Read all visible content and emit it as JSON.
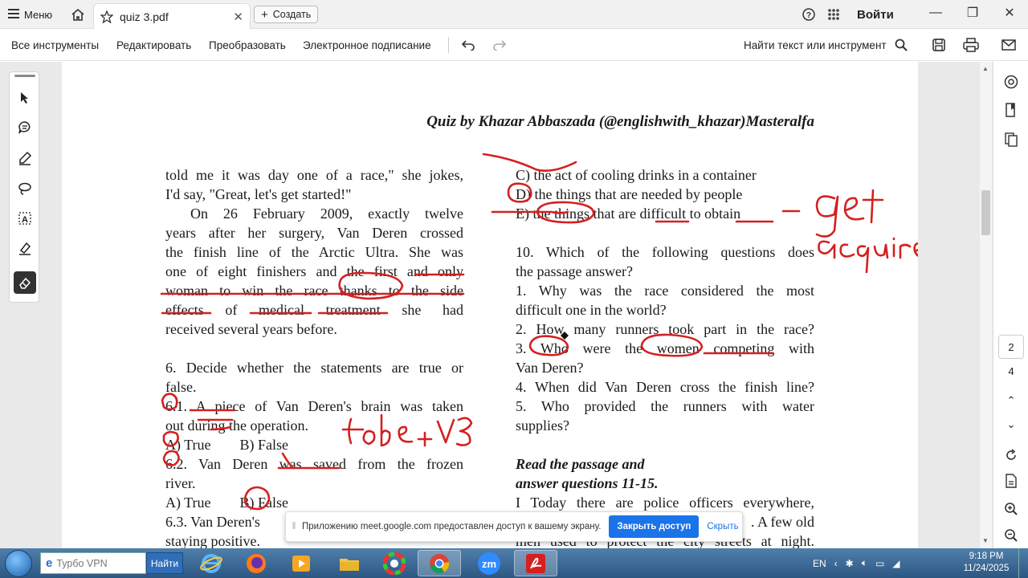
{
  "titlebar": {
    "menu_label": "Меню",
    "tab_title": "quiz 3.pdf",
    "create_label": "Создать",
    "signin_label": "Войти"
  },
  "toolbar": {
    "all_tools": "Все инструменты",
    "edit": "Редактировать",
    "convert": "Преобразовать",
    "esign": "Электронное подписание",
    "search_label": "Найти текст или инструмент"
  },
  "document": {
    "header": "Quiz by Khazar Abbaszada (@englishwith_khazar)Masteralfa",
    "col1": [
      "told me it was day one of a race,\" she jokes,",
      "I'd say, \"Great, let's get started!\"",
      "On 26 February 2009, exactly twelve",
      "years after her surgery, Van Deren crossed",
      "the finish line of the Arctic Ultra. She was",
      "one of eight finishers and the first and only",
      "woman to win the race thanks to the side",
      "effects of medical treatment she had",
      "received several years before.",
      "",
      "6. Decide whether the statements are true or",
      "false.",
      "6.1. A piece of Van Deren's brain was taken",
      "out during the operation.",
      "A) True        B) False",
      "6.2. Van Deren was saved from the frozen",
      "river.",
      "A) True        B) False",
      "6.3. Van Deren's",
      "staying positive."
    ],
    "col2": [
      "C) the act of cooling drinks in a container",
      "D) the things that are needed by people",
      "E) the things that are difficult to obtain",
      "",
      "10. Which of the following questions does",
      "the passage answer?",
      "1. Why was the race considered the most",
      "difficult one in the world?",
      "2. How many runners took part in the race?",
      "3. Who were the women competing with",
      "Van Deren?",
      "4. When did Van Deren cross the finish line?",
      "5. Who provided the runners with water",
      "supplies?",
      ""
    ],
    "read_heading_1": "Read the passage and",
    "read_heading_2": "answer questions 11-15.",
    "col2_tail": [
      "I Today there are police officers everywhere,",
      ". A few old",
      "men used to protect the city streets at night."
    ],
    "ink_notes": [
      "get",
      "acquire",
      "to be + V3"
    ]
  },
  "pagination": {
    "current": "2",
    "total": "4"
  },
  "share_banner": {
    "message": "Приложению meet.google.com предоставлен доступ к вашему экрану.",
    "stop_label": "Закрыть доступ",
    "hide_label": "Скрыть"
  },
  "taskbar": {
    "search_placeholder": "Турбо VPN",
    "go_label": "Найти",
    "lang": "EN",
    "time": "9:18 PM",
    "date": "11/24/2025"
  },
  "colors": {
    "ink": "#d42020",
    "accent": "#1a73e8",
    "taskbar": "#3b6a98"
  }
}
